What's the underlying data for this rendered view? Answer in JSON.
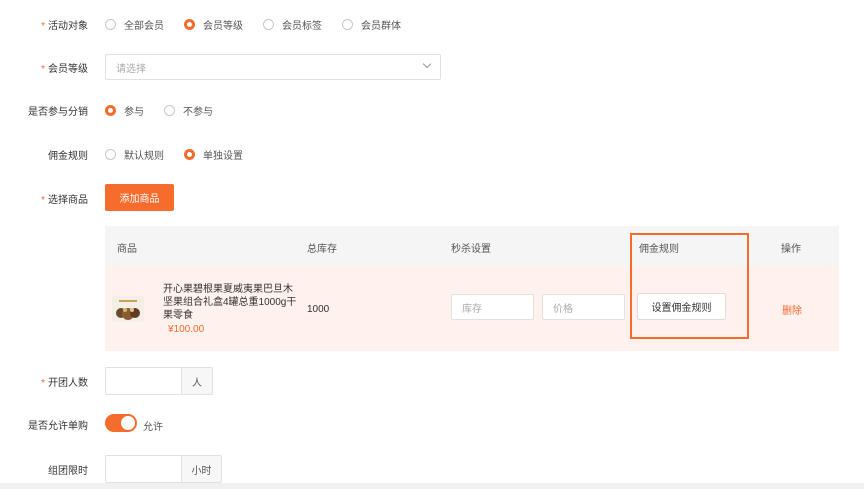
{
  "form": {
    "target": {
      "label": "活动对象",
      "options": [
        "全部会员",
        "会员等级",
        "会员标签",
        "会员群体"
      ],
      "selected_index": 1
    },
    "level": {
      "label": "会员等级",
      "placeholder": "请选择"
    },
    "distribution": {
      "label": "是否参与分销",
      "options": [
        "参与",
        "不参与"
      ],
      "selected_index": 0
    },
    "commission": {
      "label": "佣金规则",
      "options": [
        "默认规则",
        "单独设置"
      ],
      "selected_index": 1
    },
    "goods": {
      "label": "选择商品",
      "add_button": "添加商品"
    },
    "group_size": {
      "label": "开团人数",
      "unit": "人"
    },
    "allow_single": {
      "label": "是否允许单购",
      "toggle_text": "允许",
      "on": true
    },
    "time_limit": {
      "label": "组团限时",
      "unit": "小时"
    }
  },
  "table": {
    "headers": [
      "商品",
      "总库存",
      "秒杀设置",
      "佣金规则",
      "操作"
    ],
    "rows": [
      {
        "title": "开心果碧根果夏威夷果巴旦木坚果组合礼盒4罐总重1000g干果零食",
        "price": "¥100.00",
        "stock": "1000",
        "stock_placeholder": "库存",
        "price_placeholder": "价格",
        "rule_button": "设置佣金规则",
        "delete_label": "删除"
      }
    ]
  },
  "colors": {
    "accent": "#f56c2d",
    "row_highlight": "#fff1ee",
    "header_bg": "#f5f5f5"
  }
}
